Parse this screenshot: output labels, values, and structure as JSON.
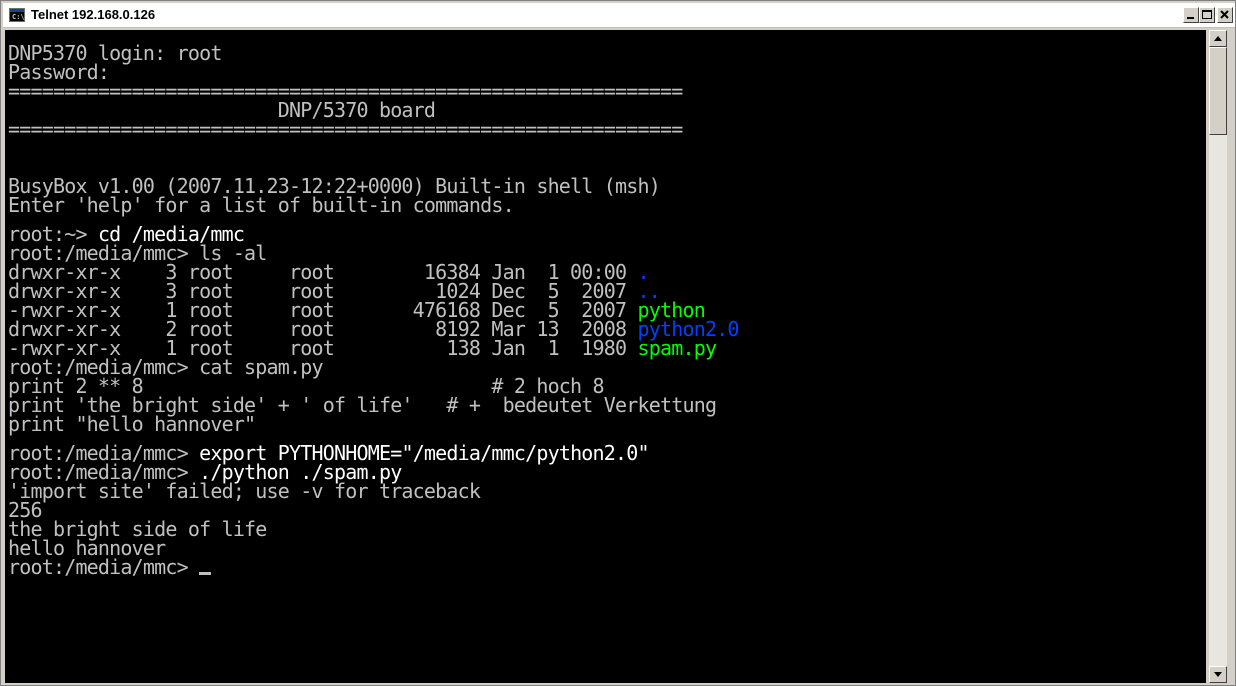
{
  "window": {
    "title": "Telnet 192.168.0.126",
    "icon": "terminal-icon",
    "icon_text": "C:\\"
  },
  "terminal": {
    "colors": {
      "default": "#c0c0c0",
      "bright": "#ffffff",
      "blue": "#0040ff",
      "green": "#00ff00",
      "background": "#000000"
    },
    "lines": [
      {
        "text": "DNP5370 login: root"
      },
      {
        "text": "Password:"
      },
      {
        "text": "============================================================"
      },
      {
        "text": "                        DNP/5370 board"
      },
      {
        "text": "============================================================"
      },
      {
        "text": ""
      },
      {
        "text": ""
      },
      {
        "text": "BusyBox v1.00 (2007.11.23-12:22+0000) Built-in shell (msh)"
      },
      {
        "text": "Enter 'help' for a list of built-in commands."
      },
      {
        "text": "",
        "gap": true
      },
      {
        "prompt": "root:~> ",
        "command": "cd /media/mmc"
      },
      {
        "text": "root:/media/mmc> ls -al"
      },
      {
        "text": "drwxr-xr-x    3 root     root        16384 Jan  1 00:00 ",
        "name": ".",
        "color": "blue"
      },
      {
        "text": "drwxr-xr-x    3 root     root         1024 Dec  5  2007 ",
        "name": "..",
        "color": "blue"
      },
      {
        "text": "-rwxr-xr-x    1 root     root       476168 Dec  5  2007 ",
        "name": "python",
        "color": "green"
      },
      {
        "text": "drwxr-xr-x    2 root     root         8192 Mar 13  2008 ",
        "name": "python2.0",
        "color": "blue"
      },
      {
        "text": "-rwxr-xr-x    1 root     root          138 Jan  1  1980 ",
        "name": "spam.py",
        "color": "green"
      },
      {
        "text": "root:/media/mmc> cat spam.py"
      },
      {
        "text": "print 2 ** 8                               # 2 hoch 8"
      },
      {
        "text": "print 'the bright side' + ' of life'   # +  bedeutet Verkettung"
      },
      {
        "text": "print \"hello hannover\""
      },
      {
        "text": "",
        "gap": true
      },
      {
        "prompt": "root:/media/mmc> ",
        "command": "export PYTHONHOME=\"/media/mmc/python2.0\""
      },
      {
        "prompt": "root:/media/mmc> ",
        "command": "./python ./spam.py"
      },
      {
        "text": "'import site' failed; use -v for traceback"
      },
      {
        "text": "256"
      },
      {
        "text": "the bright side of life"
      },
      {
        "text": "hello hannover"
      },
      {
        "text": "root:/media/mmc> ",
        "cursor": true
      }
    ]
  }
}
